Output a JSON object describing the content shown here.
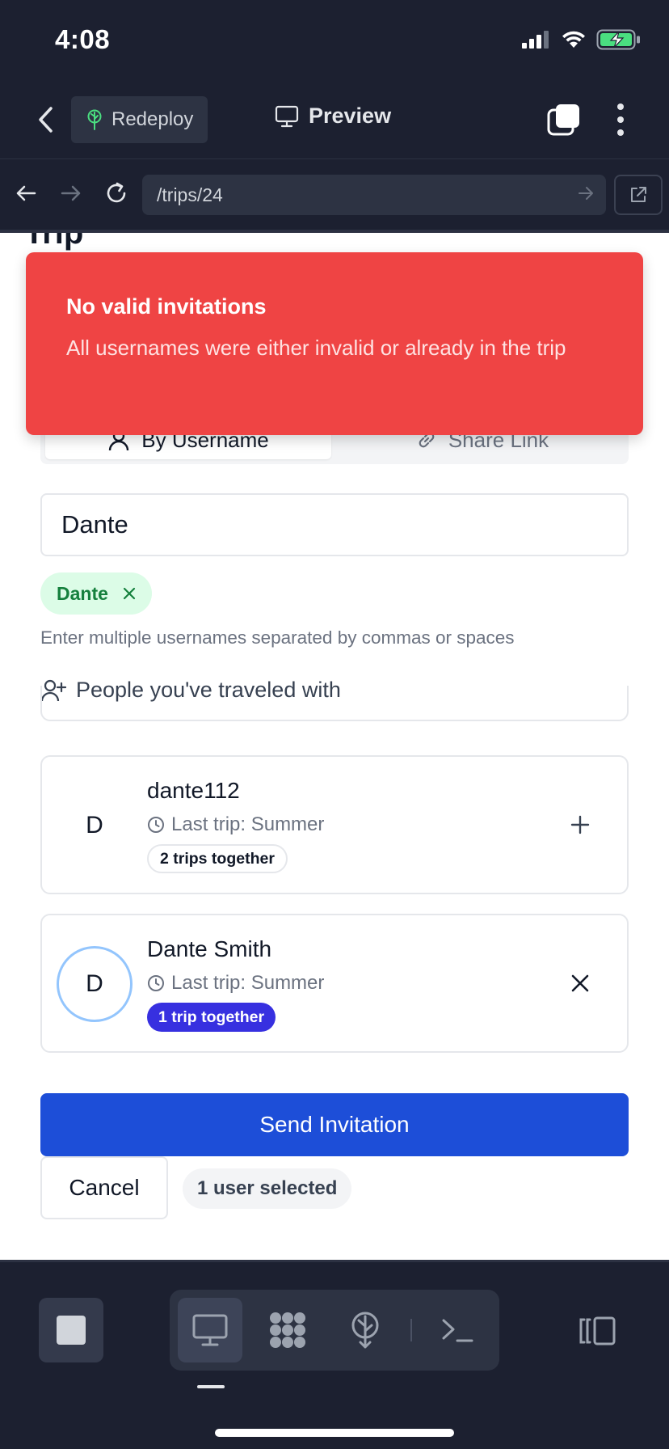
{
  "status_bar": {
    "time": "4:08"
  },
  "toolbar": {
    "redeploy_label": "Redeploy",
    "preview_label": "Preview"
  },
  "url_bar": {
    "url": "/trips/24"
  },
  "page": {
    "peek_heading": "Trip"
  },
  "toast": {
    "title": "No valid invitations",
    "description": "All usernames were either invalid or already in the trip"
  },
  "tabs": {
    "by_username": "By Username",
    "share_link": "Share Link"
  },
  "invite_form": {
    "input_value": "Dante",
    "chip_label": "Dante",
    "helper_text": "Enter multiple usernames separated by commas or spaces",
    "section_title": "People you've traveled with"
  },
  "people": [
    {
      "initial": "D",
      "name": "dante112",
      "last_trip": "Last trip: Summer",
      "badge": "2 trips together",
      "action": "add"
    },
    {
      "initial": "D",
      "name": "Dante Smith",
      "last_trip": "Last trip: Summer",
      "badge": "1 trip together",
      "action": "remove"
    }
  ],
  "actions": {
    "send_label": "Send Invitation",
    "cancel_label": "Cancel",
    "selected_count": "1 user selected"
  },
  "colors": {
    "toast_bg": "#ef4444",
    "primary": "#1d4ed8",
    "chip_bg": "#dcfce7",
    "badge_selected": "#3730e0",
    "chrome_bg": "#1c2030"
  }
}
